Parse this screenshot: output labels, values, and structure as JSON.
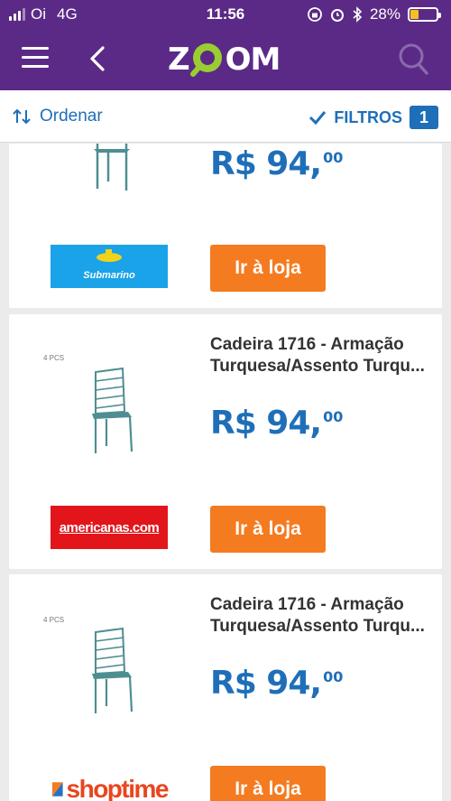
{
  "status_bar": {
    "carrier": "Oi",
    "network": "4G",
    "time": "11:56",
    "battery": "28%"
  },
  "header": {
    "logo_text_1": "Z",
    "logo_text_2": "OM"
  },
  "toolbar": {
    "sort_label": "Ordenar",
    "filter_label": "FILTROS",
    "filter_count": "1"
  },
  "products": [
    {
      "price_main": "R$ 94,",
      "price_cents": "00",
      "button": "Ir à loja",
      "store": "Submarino"
    },
    {
      "title_line1": "Cadeira 1716 - Armação",
      "title_line2": "Turquesa/Assento Turqu...",
      "pcs": "4 PCS",
      "price_main": "R$ 94,",
      "price_cents": "00",
      "button": "Ir à loja",
      "store": "americanas.com"
    },
    {
      "title_line1": "Cadeira 1716 - Armação",
      "title_line2": "Turquesa/Assento Turqu...",
      "pcs": "4 PCS",
      "price_main": "R$ 94,",
      "price_cents": "00",
      "button": "Ir à loja",
      "store": "shoptime"
    }
  ],
  "colors": {
    "header": "#5b2a86",
    "accent_blue": "#1f6fb8",
    "button_orange": "#f47b20"
  }
}
